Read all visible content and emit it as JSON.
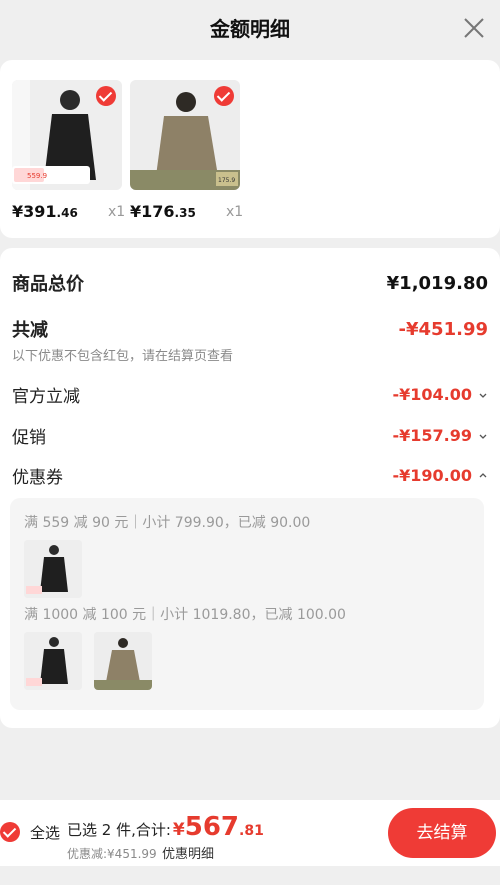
{
  "header": {
    "title": "金额明细"
  },
  "products": [
    {
      "price_int": "¥391",
      "price_dec": ".46",
      "qty": "x1",
      "tag_price": "559.9"
    },
    {
      "price_int": "¥176",
      "price_dec": ".35",
      "qty": "x1",
      "tag_price": "175.9"
    }
  ],
  "summary": {
    "total_label": "商品总价",
    "total_value": "¥1,019.80",
    "reduce_label": "共减",
    "reduce_value": "-¥451.99",
    "note": "以下优惠不包含红包，请在结算页查看",
    "official_label": "官方立减",
    "official_value": "-¥104.00",
    "promo_label": "促销",
    "promo_value": "-¥157.99",
    "coupon_label": "优惠券",
    "coupon_value": "-¥190.00"
  },
  "coupons": [
    {
      "text": "满 559 减 90 元｜小计 799.90，已减 90.00"
    },
    {
      "text": "满 1000 减 100 元｜小计 1019.80，已减 100.00"
    }
  ],
  "bottom": {
    "select_all": "全选",
    "selected": "已选 2 件,合计:",
    "yen": "¥",
    "total_int": "567",
    "total_dec": ".81",
    "discount": "优惠减:¥451.99",
    "detail": "优惠明细",
    "checkout": "去结算"
  },
  "colors": {
    "accent": "#ef3b36",
    "price_red": "#e63b2e"
  }
}
